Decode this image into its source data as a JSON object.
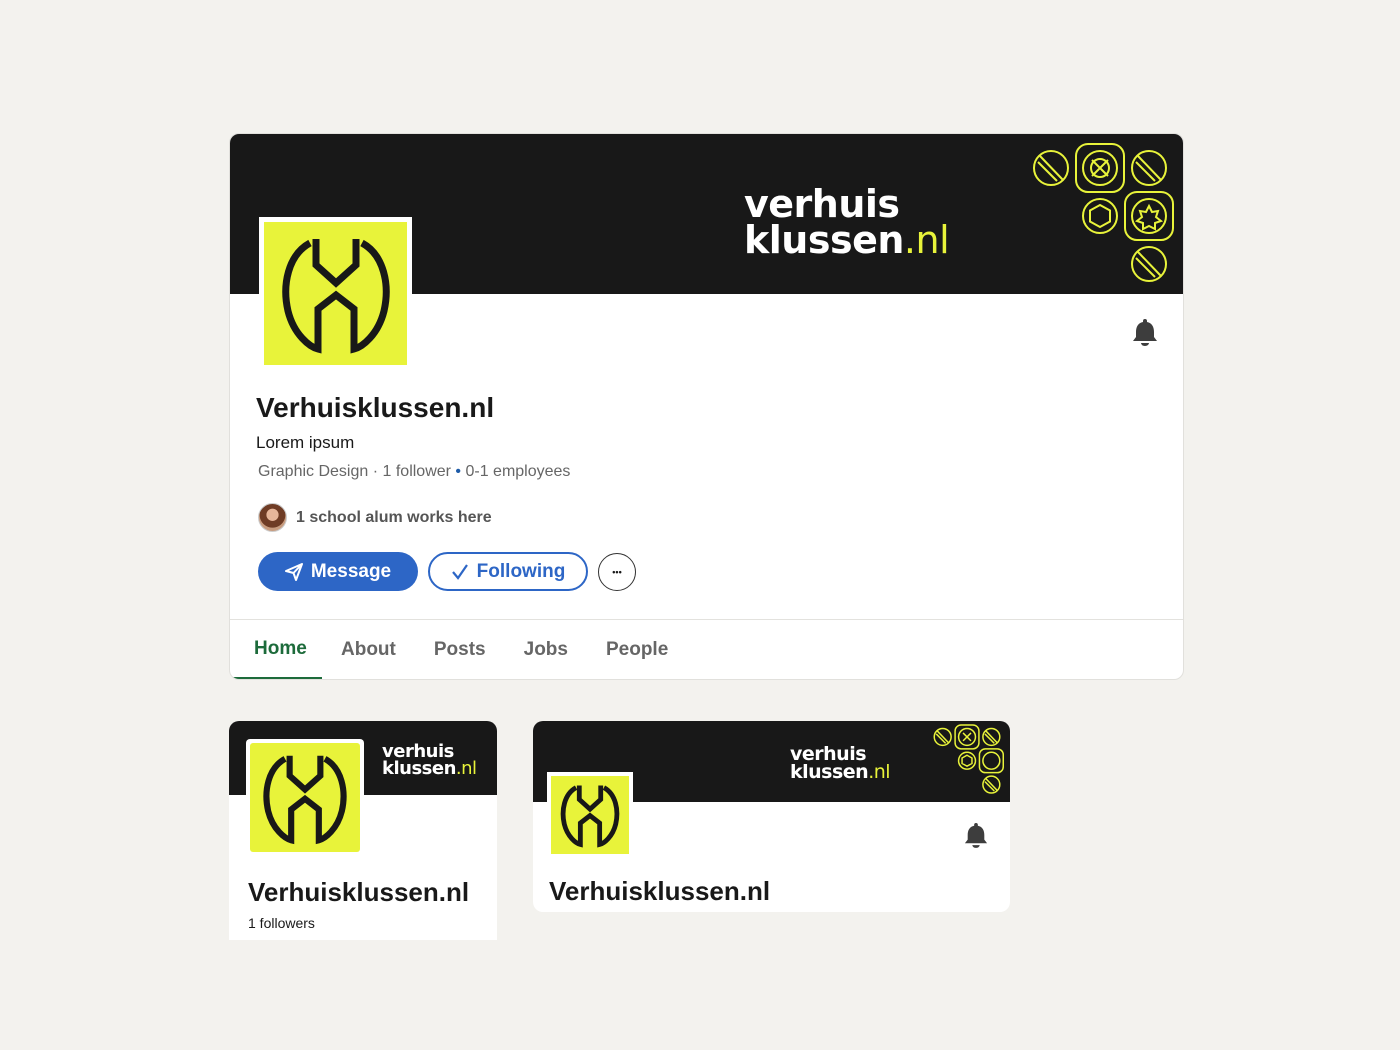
{
  "brand": {
    "wordmark_line1": "verhuis",
    "wordmark_line2": "klussen",
    "wordmark_suffix": ".nl",
    "accent_color": "#e8f33a",
    "banner_color": "#181818"
  },
  "main": {
    "company_name": "Verhuisklussen.nl",
    "tagline": "Lorem ipsum",
    "meta": {
      "industry": "Graphic Design",
      "separator1": " · ",
      "followers": "1 follower",
      "separator2": " • ",
      "employees": "0-1 employees"
    },
    "alum_text": "1 school alum works here",
    "buttons": {
      "message": "Message",
      "following": "Following",
      "more": "•••"
    },
    "tabs": [
      "Home",
      "About",
      "Posts",
      "Jobs",
      "People"
    ],
    "icons": {
      "bell": "bell-icon",
      "send": "send-icon",
      "check": "check-icon",
      "more": "more-horizontal-icon"
    }
  },
  "small_card": {
    "company_name": "Verhuisklussen.nl",
    "followers": "1 followers"
  },
  "mid_card": {
    "company_name": "Verhuisklussen.nl"
  }
}
